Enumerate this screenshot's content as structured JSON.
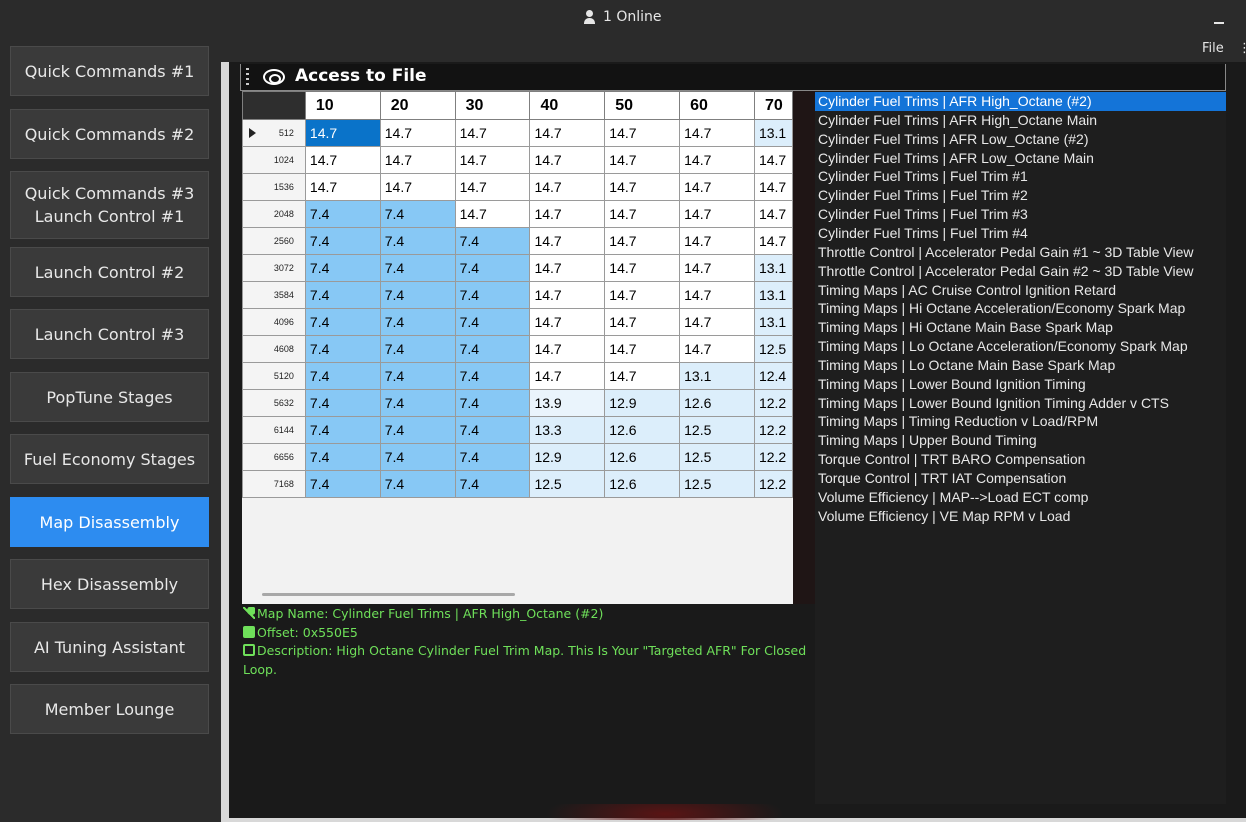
{
  "topbar": {
    "online_text": "1 Online",
    "file_menu": "File",
    "more_menu": "⋮"
  },
  "sidebar": {
    "items": [
      {
        "label": "Quick Commands #1"
      },
      {
        "label": "Quick Commands #2"
      },
      {
        "label": "Quick Commands #3\nLaunch Control #1"
      },
      {
        "label": "Launch Control #2"
      },
      {
        "label": "Launch Control #3"
      },
      {
        "label": "PopTune Stages"
      },
      {
        "label": "Fuel Economy Stages"
      },
      {
        "label": "Map Disassembly",
        "active": true
      },
      {
        "label": "Hex Disassembly"
      },
      {
        "label": "AI Tuning Assistant"
      },
      {
        "label": "Member Lounge"
      }
    ]
  },
  "panel": {
    "title": "Access to File"
  },
  "table": {
    "columns": [
      "10",
      "20",
      "30",
      "40",
      "50",
      "60",
      "70"
    ],
    "rows": [
      {
        "rpm": "512",
        "values": [
          "14.7",
          "14.7",
          "14.7",
          "14.7",
          "14.7",
          "14.7",
          "13.1"
        ]
      },
      {
        "rpm": "1024",
        "values": [
          "14.7",
          "14.7",
          "14.7",
          "14.7",
          "14.7",
          "14.7",
          "14.7"
        ]
      },
      {
        "rpm": "1536",
        "values": [
          "14.7",
          "14.7",
          "14.7",
          "14.7",
          "14.7",
          "14.7",
          "14.7"
        ]
      },
      {
        "rpm": "2048",
        "values": [
          "7.4",
          "7.4",
          "14.7",
          "14.7",
          "14.7",
          "14.7",
          "14.7"
        ]
      },
      {
        "rpm": "2560",
        "values": [
          "7.4",
          "7.4",
          "7.4",
          "14.7",
          "14.7",
          "14.7",
          "14.7"
        ]
      },
      {
        "rpm": "3072",
        "values": [
          "7.4",
          "7.4",
          "7.4",
          "14.7",
          "14.7",
          "14.7",
          "13.1"
        ]
      },
      {
        "rpm": "3584",
        "values": [
          "7.4",
          "7.4",
          "7.4",
          "14.7",
          "14.7",
          "14.7",
          "13.1"
        ]
      },
      {
        "rpm": "4096",
        "values": [
          "7.4",
          "7.4",
          "7.4",
          "14.7",
          "14.7",
          "14.7",
          "13.1"
        ]
      },
      {
        "rpm": "4608",
        "values": [
          "7.4",
          "7.4",
          "7.4",
          "14.7",
          "14.7",
          "14.7",
          "12.5"
        ]
      },
      {
        "rpm": "5120",
        "values": [
          "7.4",
          "7.4",
          "7.4",
          "14.7",
          "14.7",
          "13.1",
          "12.4"
        ]
      },
      {
        "rpm": "5632",
        "values": [
          "7.4",
          "7.4",
          "7.4",
          "13.9",
          "12.9",
          "12.6",
          "12.2"
        ]
      },
      {
        "rpm": "6144",
        "values": [
          "7.4",
          "7.4",
          "7.4",
          "13.3",
          "12.6",
          "12.5",
          "12.2"
        ]
      },
      {
        "rpm": "6656",
        "values": [
          "7.4",
          "7.4",
          "7.4",
          "12.9",
          "12.6",
          "12.5",
          "12.2"
        ]
      },
      {
        "rpm": "7168",
        "values": [
          "7.4",
          "7.4",
          "7.4",
          "12.5",
          "12.6",
          "12.5",
          "12.2"
        ]
      }
    ],
    "selected_row": 0,
    "selected_col": 0,
    "colors": {
      "low": "#87c8f5",
      "mid": "#dceefb",
      "light": "#eaf4fc",
      "white": "#ffffff",
      "selected": "#0a73c9"
    }
  },
  "map_list": [
    "Cylinder Fuel Trims | AFR High_Octane (#2)",
    "Cylinder Fuel Trims | AFR High_Octane Main",
    "Cylinder Fuel Trims | AFR Low_Octane (#2)",
    "Cylinder Fuel Trims | AFR Low_Octane Main",
    "Cylinder Fuel Trims | Fuel Trim #1",
    "Cylinder Fuel Trims | Fuel Trim #2",
    "Cylinder Fuel Trims | Fuel Trim #3",
    "Cylinder Fuel Trims | Fuel Trim #4",
    "Throttle Control | Accelerator Pedal Gain #1 ~ 3D Table View",
    "Throttle Control | Accelerator Pedal Gain #2 ~ 3D Table View",
    "Timing Maps | AC Cruise Control Ignition Retard",
    "Timing Maps | Hi Octane Acceleration/Economy Spark Map",
    "Timing Maps | Hi Octane Main Base Spark Map",
    "Timing Maps | Lo Octane Acceleration/Economy Spark Map",
    "Timing Maps | Lo Octane Main Base Spark Map",
    "Timing Maps | Lower Bound Ignition Timing",
    "Timing Maps | Lower Bound Ignition Timing Adder v CTS",
    "Timing Maps | Timing Reduction v Load/RPM",
    "Timing Maps | Upper Bound Timing",
    "Torque Control | TRT BARO Compensation",
    "Torque Control | TRT IAT Compensation",
    "Volume Efficiency | MAP-->Load ECT comp",
    "Volume Efficiency | VE Map RPM v Load"
  ],
  "map_list_selected": 0,
  "info": {
    "map_name": "Map Name: Cylinder Fuel Trims | AFR High_Octane (#2)",
    "offset": "Offset: 0x550E5",
    "description": "Description: High Octane Cylinder Fuel Trim Map. This Is Your \"Targeted AFR\" For Closed Loop."
  }
}
